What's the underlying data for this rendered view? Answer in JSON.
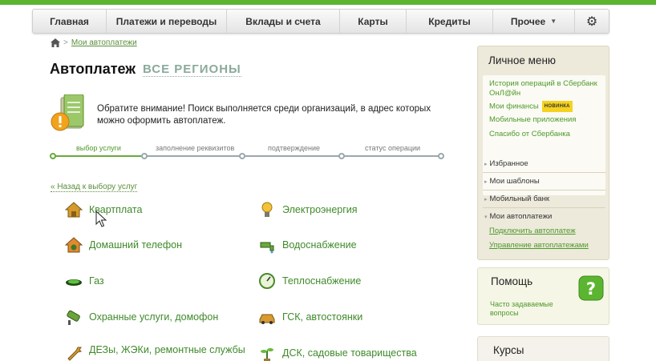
{
  "nav": {
    "items": [
      "Главная",
      "Платежи и переводы",
      "Вклады и счета",
      "Карты",
      "Кредиты",
      "Прочее"
    ],
    "gear_icon": "gear-icon"
  },
  "breadcrumb": {
    "link": "Мои автоплатежи"
  },
  "page": {
    "title": "Автоплатеж",
    "regions": "ВСЕ РЕГИОНЫ"
  },
  "notice": {
    "text": "Обратите внимание! Поиск выполняется среди организаций, в адрес которых можно оформить автоплатеж."
  },
  "steps": [
    "выбор услуги",
    "заполнение реквизитов",
    "подтверждение",
    "статус операции"
  ],
  "back_link": "« Назад к выбору услуг",
  "services": [
    "Квартплата",
    "Электроэнергия",
    "Домашний телефон",
    "Водоснабжение",
    "Газ",
    "Теплоснабжение",
    "Охранные услуги, домофон",
    "ГСК, автостоянки",
    "ДЕЗы, ЖЭКи, ремонтные службы",
    "ДСК, садовые товарищества"
  ],
  "personal_menu": {
    "title": "Личное меню",
    "links": [
      "История операций в Сбербанк ОнЛ@йн",
      "Мои финансы",
      "Мобильные приложения",
      "Спасибо от Сбербанка"
    ],
    "badge": "НОВИНКА",
    "sections": [
      "Избранное",
      "Мои шаблоны",
      "Мобильный банк",
      "Мои автоплатежи"
    ],
    "autopay_sub": [
      "Подключить автоплатеж",
      "Управление автоплатежами"
    ]
  },
  "help": {
    "title": "Помощь",
    "link": "Часто задаваемые вопросы"
  },
  "rates": {
    "title": "Курсы"
  },
  "colors": {
    "brand_green": "#5cb531",
    "link_green": "#4d9a2a",
    "badge_yellow": "#f5d21f"
  }
}
